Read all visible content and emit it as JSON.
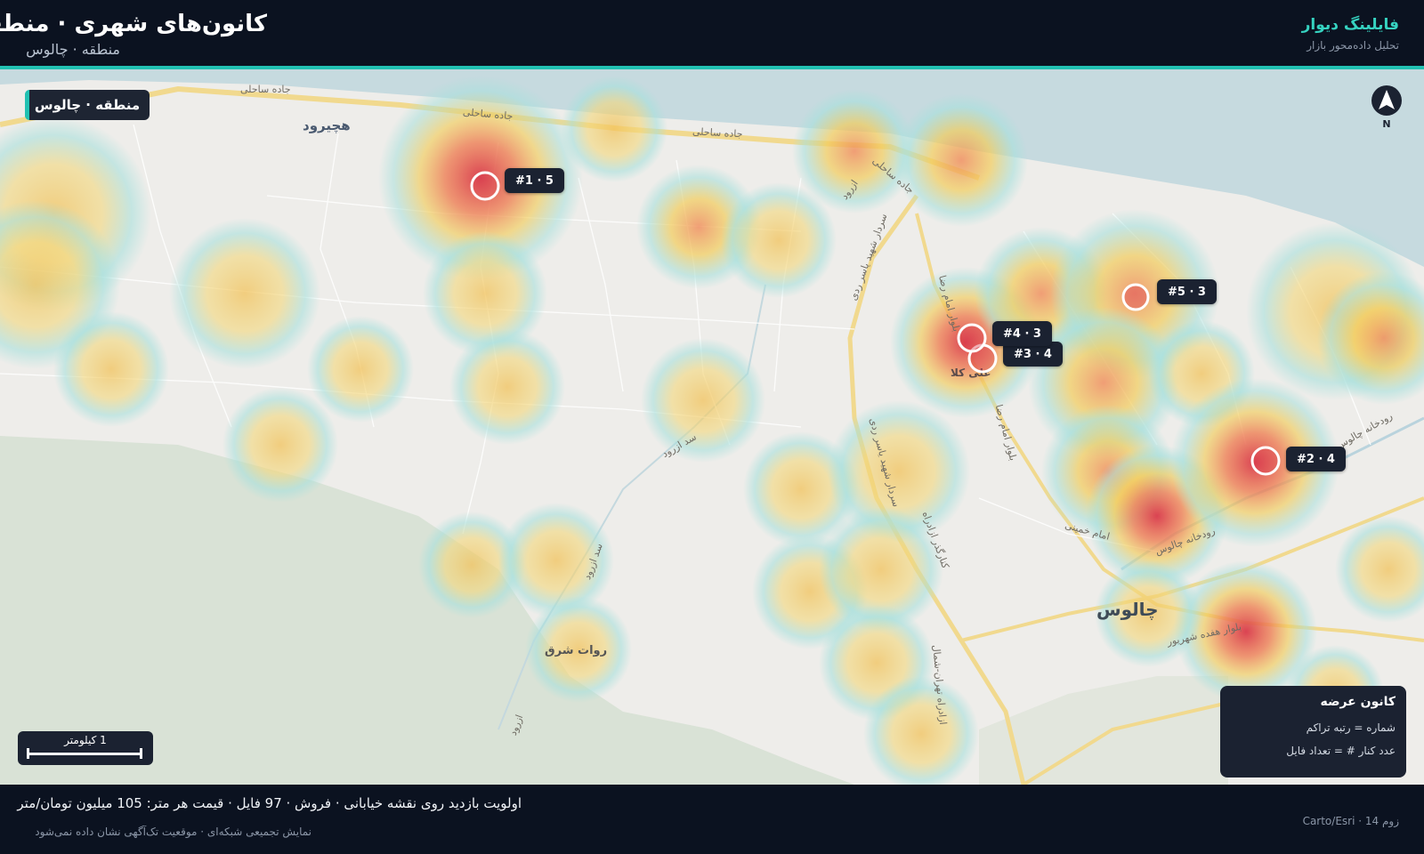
{
  "header": {
    "title": "کانون‌های شهری · منطقه",
    "subtitle": "منطقه · چالوس",
    "brand_name": "فایلینگ دیوار",
    "brand_subtitle": "تحلیل داده‌محور بازار"
  },
  "map": {
    "region_chip": "منطقه · چالوس",
    "compass_label": "N",
    "place_labels": [
      "هچیرود",
      "چالوس",
      "روات شرق",
      "علی کلا"
    ],
    "road_labels": [
      "جاده ساحلی",
      "جاده ساحلی",
      "جاده ساحلی",
      "جاده ساحلی",
      "بلوار امام رضا",
      "بلوار امام رضا",
      "سردار شهید یاسر ردی",
      "سردار شهید یاسر ردی",
      "کنارگذر ازادراه",
      "ازادراه تهران-شمال",
      "بلوار هفده شهریور",
      "رودخانه چالوس",
      "رودخانه چالوس",
      "امام خمینی",
      "سد ازرود",
      "سد ازرود",
      "ازرود",
      "ازرود"
    ],
    "markers": [
      {
        "label": "#1 · 5"
      },
      {
        "label": "#2 · 4"
      },
      {
        "label": "#3 · 4"
      },
      {
        "label": "#4 · 3"
      },
      {
        "label": "#5 · 3"
      }
    ],
    "scale_label": "1 کیلومتر",
    "legend": {
      "title": "کانون عرضه",
      "line1": "شماره = رتبه تراکم",
      "line2": "عدد کنار # = تعداد فایل"
    }
  },
  "footer": {
    "summary": "اولویت بازدید روی نقشه خیابانی · فروش · 97 فایل · قیمت هر متر: 105 میلیون تومان/متر",
    "note": "نمایش تجمیعی شبکه‌ای · موقعیت تک‌آگهی نشان داده نمی‌شود",
    "attribution": "زوم 14 · Carto/Esri"
  },
  "colors": {
    "accent": "#21c1b2",
    "background": "#0b1220",
    "panel": "#1b2231",
    "heat_low": "#a8e0dc",
    "heat_mid": "#f2cc5a",
    "heat_high": "#d93a4a"
  }
}
